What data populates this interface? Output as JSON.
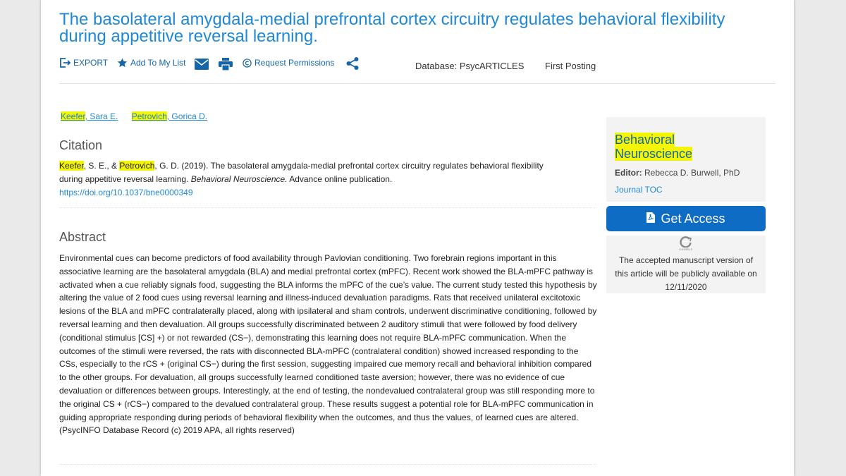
{
  "article": {
    "title": "The basolateral amygdala-medial prefrontal cortex circuitry regulates behavioral flexibility during appetitive reversal learning."
  },
  "toolbar": {
    "export_label": "EXPORT",
    "add_list_label": "Add To My List",
    "permissions_label": "Request Permissions",
    "database_label": "Database: PsycARTICLES",
    "first_posting_label": "First Posting"
  },
  "authors": [
    {
      "hl": "Keefer",
      "rest": ", Sara E."
    },
    {
      "hl": "Petrovich",
      "rest": ", Gorica D."
    }
  ],
  "citation": {
    "heading": "Citation",
    "author1_hl": "Keefer",
    "mid1": ", S. E., & ",
    "author2_hl": "Petrovich",
    "mid2": ", G. D. (2019). The basolateral amygdala-medial prefrontal cortex circuitry regulates behavioral flexibility during appetitive reversal learning. ",
    "journal_italic": "Behavioral Neuroscience.",
    "tail": " Advance online publication.",
    "doi": "https://doi.org/10.1037/bne0000349"
  },
  "abstract": {
    "heading": "Abstract",
    "text": "Environmental cues can become predictors of food availability through Pavlovian conditioning. Two forebrain regions important in this associative learning are the basolateral amygdala (BLA) and medial prefrontal cortex (mPFC). Recent work showed the BLA-mPFC pathway is activated when a cue reliably signals food, suggesting the BLA informs the mPFC of the cue’s value. The current study tested this hypothesis by altering the value of 2 food cues using reversal learning and illness-induced devaluation paradigms. Rats that received unilateral excitotoxic lesions of the BLA and mPFC contralaterally placed, along with ipsilateral and sham controls, underwent discriminative conditioning, followed by reversal learning and then devaluation. All groups successfully discriminated between 2 auditory stimuli that were followed by food delivery (conditional stimulus [CS] +) or not rewarded (CS−), demonstrating this learning does not require BLA-mPFC communication. When the outcomes of the stimuli were reversed, the rats with disconnected BLA-mPFC (contralateral condition) showed increased responding to the CSs, especially to the rCS + (original CS−) during the first session, suggesting impaired cue memory recall and behavioral inhibition compared to the other groups. For devaluation, all groups successfully learned conditioned taste aversion; however, there was no evidence of cue devaluation or differences between groups. Interestingly, at the end of testing, the nondevalued contralateral group was still responding more to the original CS + (rCS−) compared to the devalued contralateral group. These results suggest a potential role for BLA-mPFC communication in guiding appropriate responding during periods of behavioral flexibility when the outcomes, and thus the values, of learned cues are altered. (PsycINFO Database Record (c) 2019 APA, all rights reserved)"
  },
  "sidebar": {
    "journal_line1": "Behavioral",
    "journal_line2": "Neuroscience",
    "editor_label": "Editor:",
    "editor_name": " Rebecca D. Burwell, PhD",
    "toc_label": "Journal TOC",
    "get_access_label": "Get Access",
    "chorus_logo_text": "CHORUS",
    "chorus_line1": "The accepted manuscript version of",
    "chorus_line2": "this article will be publicly available on",
    "chorus_line3": "12/11/2020"
  },
  "colors": {
    "link": "#1e88d6",
    "highlight": "#f4f407",
    "button": "#0e6cc4"
  }
}
